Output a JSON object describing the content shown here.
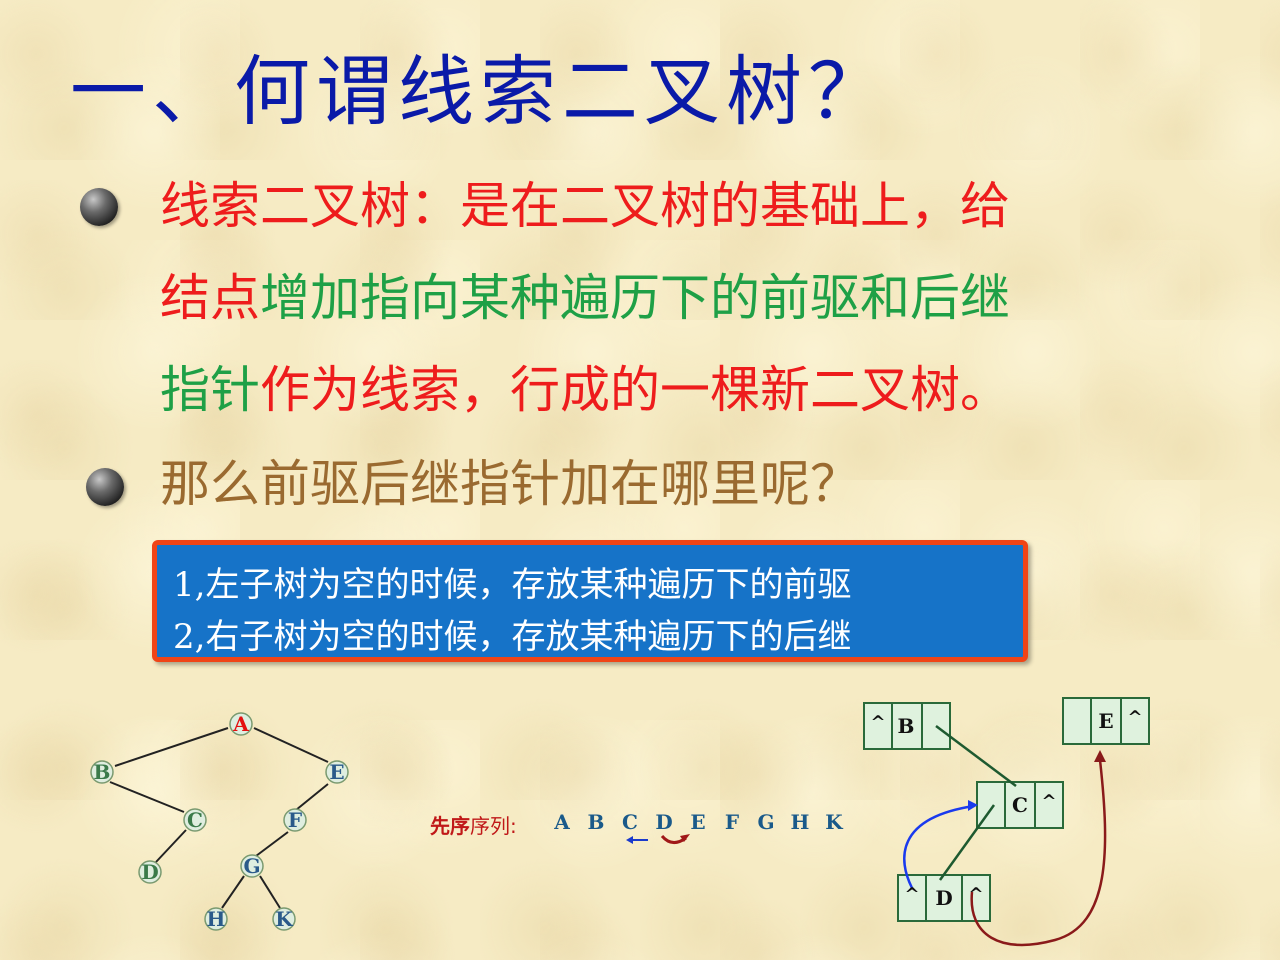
{
  "title": "一、何谓线索二叉树？",
  "definition": {
    "line1": "线索二叉树：是在二叉树的基础上，给",
    "line2_red": "结点",
    "line2_green": "增加指向某种遍历下的前驱和后继",
    "line3_green": "指针",
    "line3_red": "作为线索，行成的一棵新二叉树。"
  },
  "question": "那么前驱后继指针加在哪里呢？",
  "rules": [
    "1,左子树为空的时候，存放某种遍历下的前驱",
    "2,右子树为空的时候，存放某种遍历下的后继"
  ],
  "tree": {
    "nodes": [
      "A",
      "B",
      "E",
      "C",
      "F",
      "D",
      "G",
      "H",
      "K"
    ]
  },
  "sequence": {
    "label_bold": "先序",
    "label_rest": "序列:",
    "letters": [
      "A",
      "B",
      "C",
      "D",
      "E",
      "F",
      "G",
      "H",
      "K"
    ]
  },
  "thread_nodes": {
    "b": {
      "left": "^",
      "data": "B"
    },
    "e": {
      "data": "E",
      "right": "^"
    },
    "c": {
      "data": "C",
      "right": "^"
    },
    "d": {
      "left": "^",
      "data": "D",
      "right": "^"
    }
  },
  "colors": {
    "title": "#0a1aa8",
    "red": "#ee1c1c",
    "green": "#1ea046",
    "brown": "#9a6a30",
    "box_fill": "#1673c8",
    "box_border": "#f04416"
  }
}
